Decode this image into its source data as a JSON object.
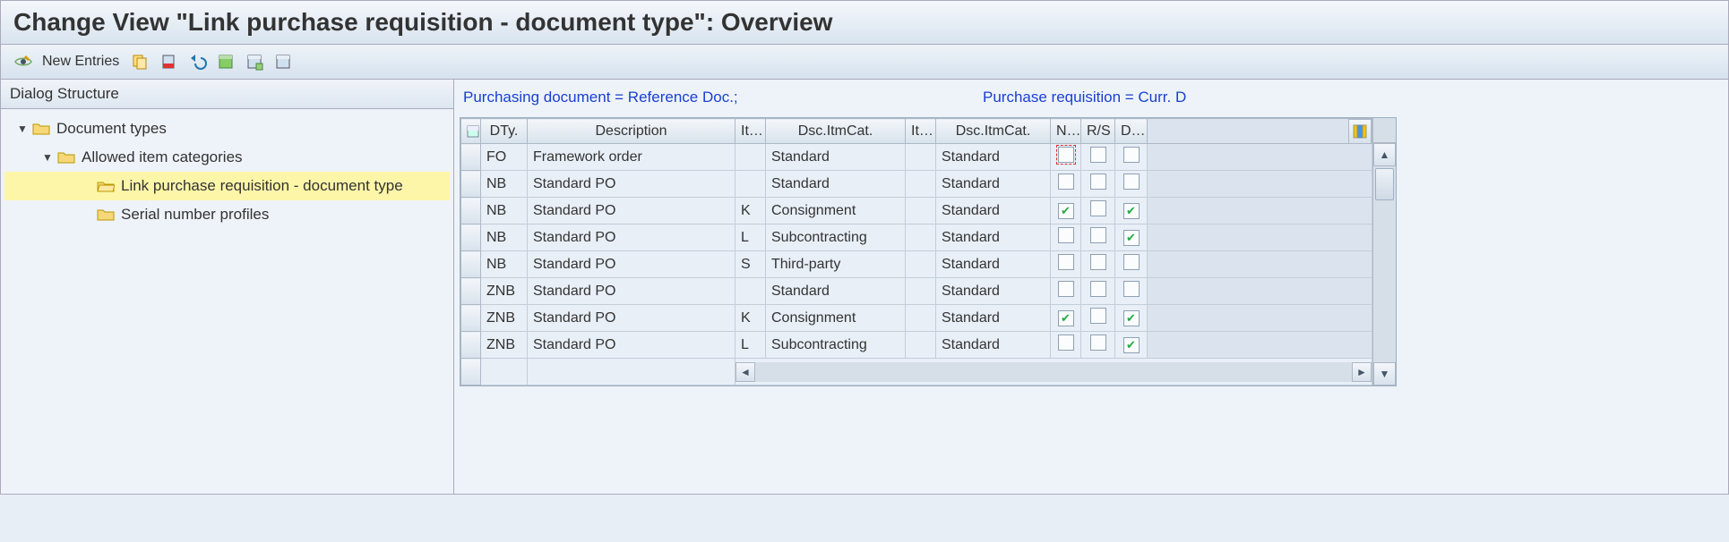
{
  "title": "Change View \"Link purchase requisition - document type\": Overview",
  "toolbar": {
    "new_entries_label": "New Entries"
  },
  "dialog_structure": {
    "header": "Dialog Structure",
    "items": [
      {
        "label": "Document types",
        "level": 1,
        "expanded": true,
        "active": false,
        "icon": "folder"
      },
      {
        "label": "Allowed item categories",
        "level": 2,
        "expanded": true,
        "active": false,
        "icon": "folder"
      },
      {
        "label": "Link purchase requisition - document type",
        "level": 3,
        "expanded": false,
        "active": true,
        "icon": "folder-open"
      },
      {
        "label": "Serial number profiles",
        "level": 3,
        "expanded": false,
        "active": false,
        "icon": "folder"
      }
    ]
  },
  "context": {
    "left": "Purchasing document = Reference Doc.;",
    "right": "Purchase requisition = Curr. D"
  },
  "table": {
    "columns": [
      "DTy.",
      "Description",
      "It…",
      "Dsc.ItmCat.",
      "It…",
      "Dsc.ItmCat.",
      "N…",
      "R/S",
      "D…"
    ],
    "rows": [
      {
        "dty": "FO",
        "desc": "Framework order",
        "it1": "",
        "dsc1": "Standard",
        "it2": "",
        "dsc2": "Standard",
        "n": false,
        "rs": false,
        "d": false,
        "n_focus": true
      },
      {
        "dty": "NB",
        "desc": "Standard PO",
        "it1": "",
        "dsc1": "Standard",
        "it2": "",
        "dsc2": "Standard",
        "n": false,
        "rs": false,
        "d": false
      },
      {
        "dty": "NB",
        "desc": "Standard PO",
        "it1": "K",
        "dsc1": "Consignment",
        "it2": "",
        "dsc2": "Standard",
        "n": true,
        "rs": false,
        "d": true
      },
      {
        "dty": "NB",
        "desc": "Standard PO",
        "it1": "L",
        "dsc1": "Subcontracting",
        "it2": "",
        "dsc2": "Standard",
        "n": false,
        "rs": false,
        "d": true
      },
      {
        "dty": "NB",
        "desc": "Standard PO",
        "it1": "S",
        "dsc1": "Third-party",
        "it2": "",
        "dsc2": "Standard",
        "n": false,
        "rs": false,
        "d": false
      },
      {
        "dty": "ZNB",
        "desc": "Standard PO",
        "it1": "",
        "dsc1": "Standard",
        "it2": "",
        "dsc2": "Standard",
        "n": false,
        "rs": false,
        "d": false
      },
      {
        "dty": "ZNB",
        "desc": "Standard PO",
        "it1": "K",
        "dsc1": "Consignment",
        "it2": "",
        "dsc2": "Standard",
        "n": true,
        "rs": false,
        "d": true
      },
      {
        "dty": "ZNB",
        "desc": "Standard PO",
        "it1": "L",
        "dsc1": "Subcontracting",
        "it2": "",
        "dsc2": "Standard",
        "n": false,
        "rs": false,
        "d": true
      }
    ]
  }
}
